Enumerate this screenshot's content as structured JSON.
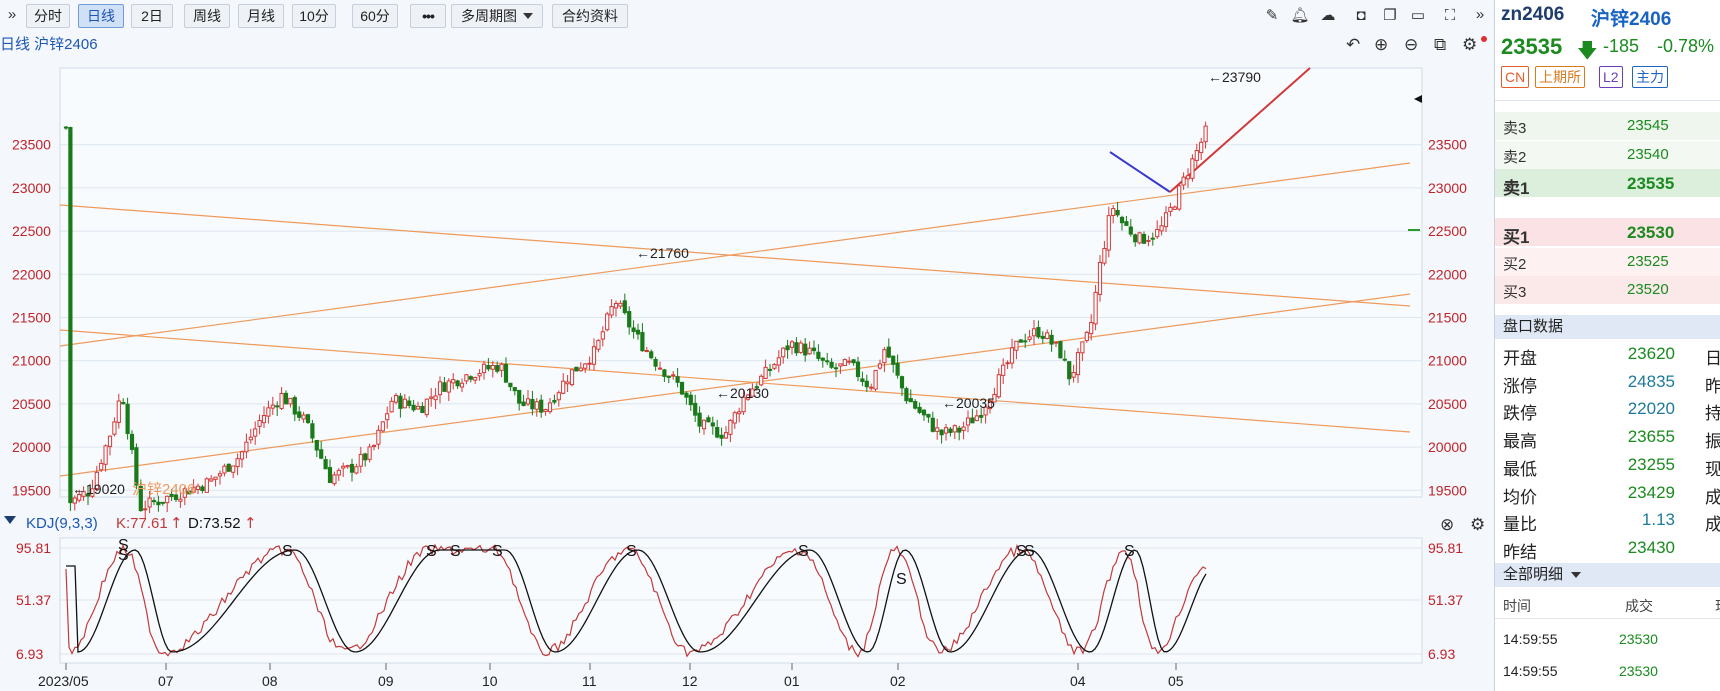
{
  "toolbar": {
    "expand_left": "»",
    "tabs": [
      {
        "label": "分时",
        "active": false
      },
      {
        "label": "日线",
        "active": true
      },
      {
        "label": "2日",
        "active": false
      },
      {
        "label": "周线",
        "active": false
      },
      {
        "label": "月线",
        "active": false
      },
      {
        "label": "10分",
        "active": false
      },
      {
        "label": "60分",
        "active": false
      }
    ],
    "more": "•••",
    "multi_period": "多周期图",
    "contract_info": "合约资料",
    "right_icons": [
      "pencil-icon",
      "bell-icon",
      "cloud-icon",
      "camera-icon",
      "windows-icon",
      "monitor-icon",
      "fullscreen-icon"
    ],
    "collapse_right": "»"
  },
  "chart": {
    "title": "日线 沪锌2406",
    "series_label": "沪锌2406",
    "top_icons": [
      "undo-icon",
      "zoom-in-icon",
      "zoom-out-icon",
      "copy-icon",
      "settings-icon"
    ],
    "y_ticks": [
      "23500",
      "23000",
      "22500",
      "22000",
      "21500",
      "21000",
      "20500",
      "20000",
      "19500"
    ],
    "annotations": [
      "←23790",
      "←21760",
      "←20130",
      "←20035",
      "←19020"
    ],
    "x_ticks": [
      "2023/05",
      "07",
      "08",
      "09",
      "10",
      "11",
      "12",
      "01",
      "02",
      "04",
      "05"
    ]
  },
  "kdj": {
    "label": "KDJ(9,3,3)",
    "k_label": "K:77.61",
    "d_label": "D:73.52",
    "y_ticks": [
      "95.81",
      "51.37",
      "6.93"
    ],
    "marker": "S"
  },
  "panel": {
    "code": "zn2406",
    "name": "沪锌2406",
    "price": "23535",
    "change": "-185",
    "change_pct": "-0.78%",
    "tags": [
      {
        "label": "CN",
        "color": "#e65c2a"
      },
      {
        "label": "上期所",
        "color": "#d97a1e"
      },
      {
        "label": "L2",
        "color": "#6a3fb8"
      },
      {
        "label": "主力",
        "color": "#1f65c4"
      }
    ],
    "asks": [
      {
        "label": "卖3",
        "value": "23545"
      },
      {
        "label": "卖2",
        "value": "23540"
      },
      {
        "label": "卖1",
        "value": "23535"
      }
    ],
    "bids": [
      {
        "label": "买1",
        "value": "23530"
      },
      {
        "label": "买2",
        "value": "23525"
      },
      {
        "label": "买3",
        "value": "23520"
      }
    ],
    "data_title": "盘口数据",
    "stats": [
      {
        "k": "开盘",
        "v": "23620",
        "x": "日",
        "color": "#1b8a1f"
      },
      {
        "k": "涨停",
        "v": "24835",
        "x": "昨",
        "color": "#1f7a9c"
      },
      {
        "k": "跌停",
        "v": "22020",
        "x": "持",
        "color": "#1f7a9c"
      },
      {
        "k": "最高",
        "v": "23655",
        "x": "振",
        "color": "#1b8a1f"
      },
      {
        "k": "最低",
        "v": "23255",
        "x": "现",
        "color": "#1b8a1f"
      },
      {
        "k": "均价",
        "v": "23429",
        "x": "成",
        "color": "#1b8a1f"
      },
      {
        "k": "量比",
        "v": "1.13",
        "x": "成",
        "color": "#1f7a9c"
      },
      {
        "k": "昨结",
        "v": "23430",
        "x": "",
        "color": "#1b8a1f"
      }
    ],
    "trades_title": "全部明细",
    "trade_headers": [
      "时间",
      "成交",
      "现"
    ],
    "trades": [
      {
        "time": "14:59:55",
        "price": "23530"
      },
      {
        "time": "14:59:55",
        "price": "23530"
      }
    ]
  },
  "colors": {
    "up": "#d23838",
    "down": "#1a7a1a",
    "trend": "#ee9a5c",
    "kline": "#c23a3a",
    "dline": "#111111",
    "panel_green": "#1b8a1f",
    "blue_text": "#1d57b4"
  }
}
